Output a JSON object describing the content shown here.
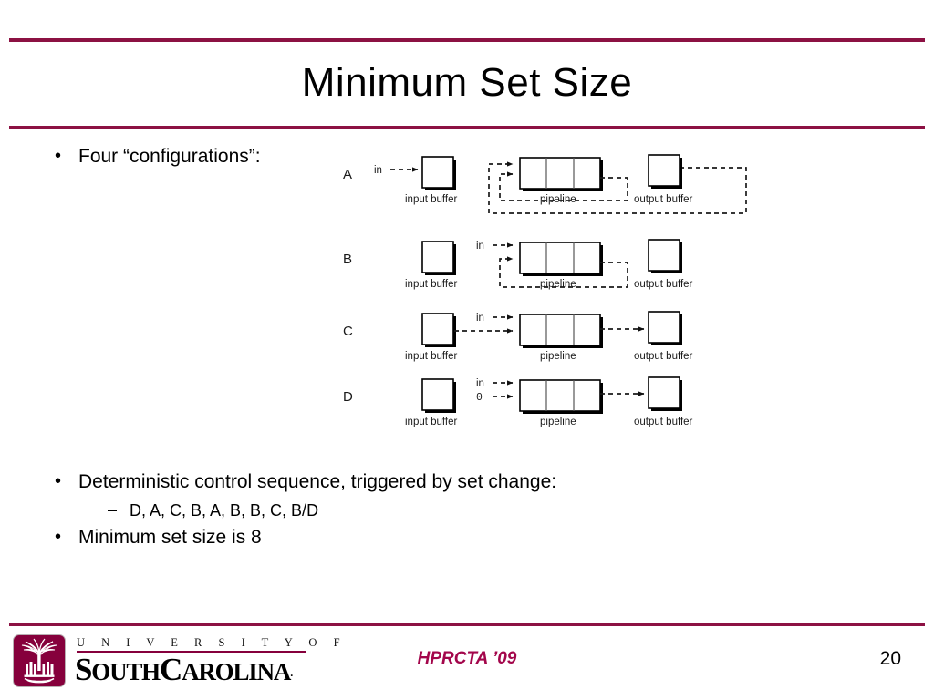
{
  "slide": {
    "title": "Minimum Set Size",
    "page_number": "20",
    "conference": "HPRCTA ’09",
    "accent_color": "#8c1143",
    "logo_maroon": "#86003c"
  },
  "bullets": {
    "four_configurations": "Four “configurations”:",
    "deterministic": "Deterministic control sequence, triggered by set change:",
    "sequence": "D, A, C, B, A, B, B, C, B/D",
    "minimum_set_size": "Minimum set size is 8"
  },
  "diagram": {
    "captions": {
      "input_buffer": "input buffer",
      "pipeline": "pipeline",
      "output_buffer": "output buffer"
    },
    "signals": {
      "in": "in",
      "zero": "0"
    },
    "rows": [
      {
        "letter": "A",
        "in_target": "input-buffer",
        "feedback_loops": 2,
        "output_buffer_feedback": true
      },
      {
        "letter": "B",
        "in_target": "pipeline",
        "feedback_loops": 1,
        "output_buffer_feedback": false
      },
      {
        "letter": "C",
        "in_target": "pipeline",
        "feedback_loops": 0,
        "output_buffer_feedback": false
      },
      {
        "letter": "D",
        "in_target": "pipeline",
        "feedback_loops": 0,
        "output_buffer_feedback": false
      }
    ]
  },
  "logo": {
    "university_line": "U N I V E R S I T Y   O F",
    "south": "S",
    "south_rest": "OUTH",
    "carolina_c": "C",
    "carolina_rest": "AROLINA",
    "trademark": "."
  }
}
